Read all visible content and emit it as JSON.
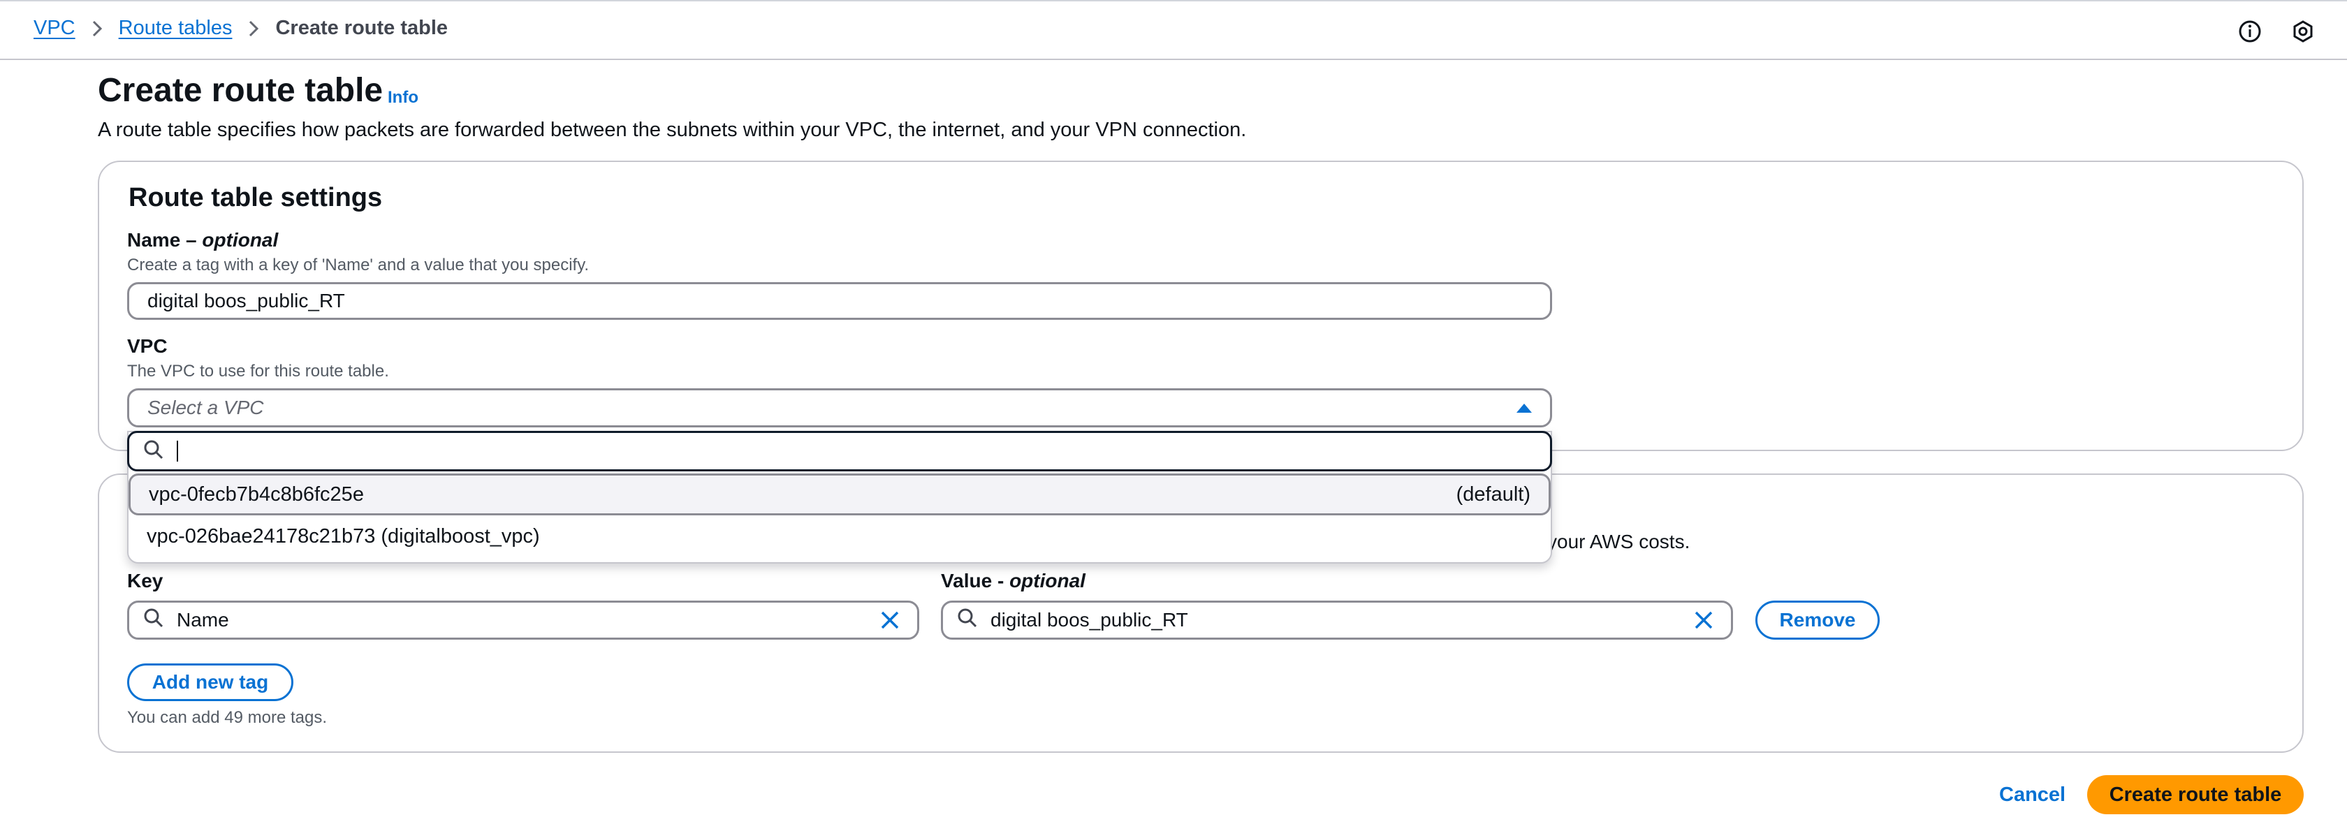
{
  "breadcrumb": {
    "items": [
      "VPC",
      "Route tables"
    ],
    "current": "Create route table"
  },
  "header": {
    "title": "Create route table",
    "info": "Info",
    "description": "A route table specifies how packets are forwarded between the subnets within your VPC, the internet, and your VPN connection."
  },
  "settings": {
    "heading": "Route table settings",
    "name_label": "Name",
    "name_optional": "optional",
    "name_hint": "Create a tag with a key of 'Name' and a value that you specify.",
    "name_value": "digital boos_public_RT",
    "vpc_label": "VPC",
    "vpc_hint": "The VPC to use for this route table.",
    "vpc_placeholder": "Select a VPC"
  },
  "vpc_dropdown": {
    "search_value": "",
    "options": [
      {
        "label": "vpc-0fecb7b4c8b6fc25e",
        "tag": "(default)"
      },
      {
        "label": "vpc-026bae24178c21b73 (digitalboost_vpc)",
        "tag": ""
      }
    ]
  },
  "tags": {
    "hint_visible_fragment": "your AWS costs.",
    "key_label": "Key",
    "value_label": "Value",
    "value_optional": "optional",
    "rows": [
      {
        "key": "Name",
        "value": "digital boos_public_RT"
      }
    ],
    "remove_label": "Remove",
    "add_label": "Add new tag",
    "limit_note": "You can add 49 more tags."
  },
  "footer": {
    "cancel": "Cancel",
    "submit": "Create route table"
  },
  "colors": {
    "link": "#0972d3",
    "primary": "#ff9900",
    "border": "#8c8c94"
  }
}
